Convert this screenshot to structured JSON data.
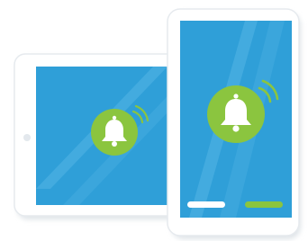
{
  "illustration": {
    "devices": [
      {
        "kind": "tablet",
        "orientation": "landscape",
        "icon": "bell-ringing-icon"
      },
      {
        "kind": "phone",
        "orientation": "portrait",
        "icon": "bell-ringing-icon"
      }
    ],
    "colors": {
      "screen": "#2f9fd8",
      "screen_stripe": "#53b5e6",
      "bell_badge": "#8bc53f",
      "bell": "#ffffff",
      "frame": "#ffffff",
      "frame_border": "#e6eaee",
      "shadow": "#dfe4e8",
      "bar_left": "#ffffff",
      "bar_right": "#8bc53f"
    }
  }
}
